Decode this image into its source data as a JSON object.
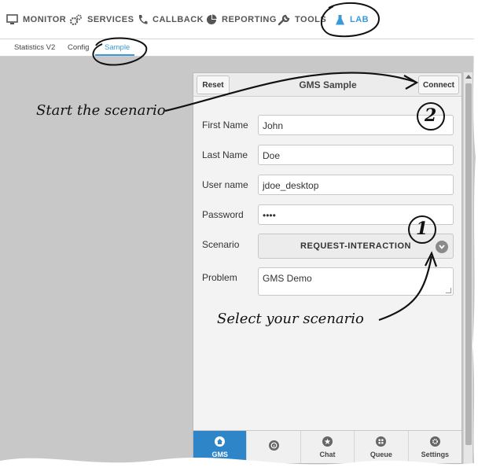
{
  "nav": {
    "items": [
      {
        "label": "MONITOR",
        "icon": "monitor-icon"
      },
      {
        "label": "SERVICES",
        "icon": "gears-icon"
      },
      {
        "label": "CALLBACK",
        "icon": "phone-icon"
      },
      {
        "label": "REPORTING",
        "icon": "pie-chart-icon"
      },
      {
        "label": "TOOLS",
        "icon": "wrench-icon"
      },
      {
        "label": "LAB",
        "icon": "flask-icon",
        "active": true
      }
    ]
  },
  "subnav": {
    "items": [
      {
        "label": "Statistics V2"
      },
      {
        "label": "Config"
      },
      {
        "label": "Sample",
        "active": true
      }
    ]
  },
  "panel": {
    "reset_label": "Reset",
    "title": "GMS Sample",
    "connect_label": "Connect",
    "fields": {
      "first_name": {
        "label": "First Name",
        "value": "John"
      },
      "last_name": {
        "label": "Last Name",
        "value": "Doe"
      },
      "user_name": {
        "label": "User name",
        "value": "jdoe_desktop"
      },
      "password": {
        "label": "Password",
        "value": "••••"
      },
      "scenario": {
        "label": "Scenario",
        "value": "REQUEST-INTERACTION"
      },
      "problem": {
        "label": "Problem",
        "value": "GMS Demo"
      }
    },
    "tabs": [
      {
        "label": "GMS",
        "icon": "home-icon",
        "active": true
      },
      {
        "label": "",
        "icon": "info-icon"
      },
      {
        "label": "Chat",
        "icon": "star-icon"
      },
      {
        "label": "Queue",
        "icon": "grid-icon"
      },
      {
        "label": "Settings",
        "icon": "gear-icon"
      }
    ]
  },
  "annotations": {
    "start": "Start the scenario",
    "select": "Select your scenario",
    "badge_connect": "2",
    "badge_scenario": "1"
  },
  "colors": {
    "accent": "#3a9ad9",
    "active_tab": "#2e86c9",
    "background": "#c8c8c8"
  }
}
